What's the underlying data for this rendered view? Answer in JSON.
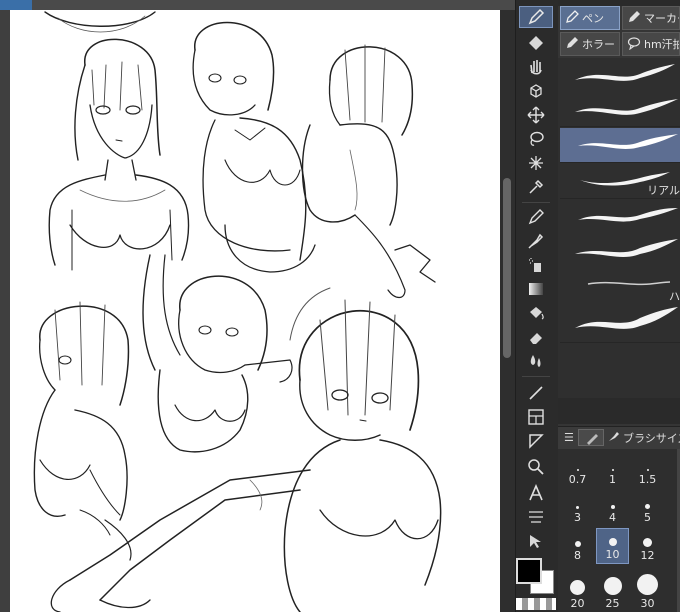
{
  "subtool_tabs": [
    {
      "label": "ペン",
      "icon": "pen-icon",
      "active": true
    },
    {
      "label": "マーカー",
      "icon": "marker-icon",
      "active": false
    },
    {
      "label": "ホラー",
      "icon": "pen-icon",
      "active": false
    },
    {
      "label": "hm汗拍",
      "icon": "speech-bubble-icon",
      "active": false
    }
  ],
  "brush_list": {
    "labels": [
      "リアル",
      "ハ"
    ],
    "selected_index": 2
  },
  "brush_size_panel": {
    "title": "ブラシサイズ",
    "sizes": [
      "0.7",
      "1",
      "1.5",
      "3",
      "4",
      "5",
      "8",
      "10",
      "12",
      "20",
      "25",
      "30"
    ],
    "selected": "10"
  },
  "colors": {
    "main": "#000000",
    "sub": "#ffffff",
    "selection_accent": "#5d6e92",
    "ui_background": "#353535"
  },
  "tools": [
    "pen-tool-icon",
    "fill-tool-icon",
    "hand-icon",
    "object-select-icon",
    "move-icon",
    "lasso-icon",
    "magic-wand-icon",
    "eyedropper-icon",
    "pen-nib-icon",
    "brush-icon",
    "airbrush-icon",
    "gradient-icon",
    "fill-bucket-icon",
    "eraser-icon",
    "blend-icon",
    "line-icon",
    "frame-icon",
    "ruler-icon",
    "zoom-icon",
    "text-icon",
    "correct-line-icon",
    "operation-icon"
  ]
}
